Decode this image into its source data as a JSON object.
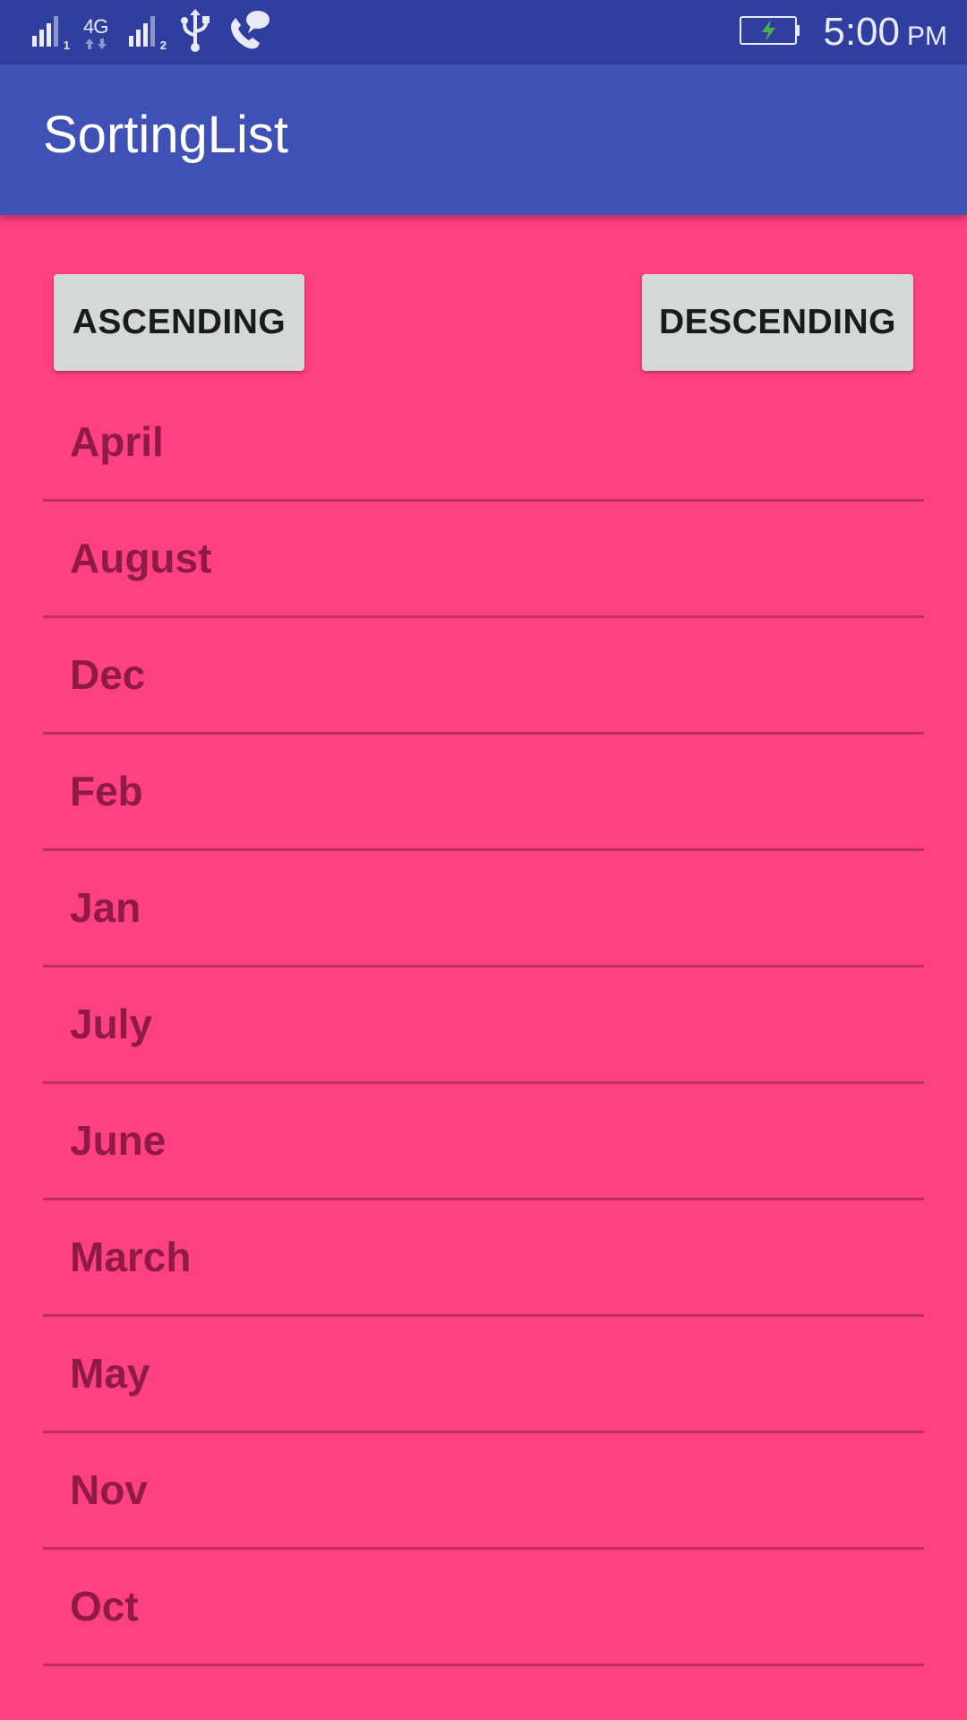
{
  "status_bar": {
    "sim1_label": "1",
    "network_label": "4G",
    "sim2_label": "2",
    "icons": [
      "signal-icon",
      "4g-icon",
      "signal-icon",
      "usb-icon",
      "phone-chat-icon",
      "battery-charging-icon"
    ],
    "time": "5:00",
    "ampm": "PM"
  },
  "app_bar": {
    "title": "SortingList"
  },
  "buttons": {
    "ascending": "ASCENDING",
    "descending": "DESCENDING"
  },
  "months": [
    {
      "label": "April"
    },
    {
      "label": "August"
    },
    {
      "label": "Dec"
    },
    {
      "label": "Feb"
    },
    {
      "label": "Jan"
    },
    {
      "label": "July"
    },
    {
      "label": "June"
    },
    {
      "label": "March"
    },
    {
      "label": "May"
    },
    {
      "label": "Nov"
    },
    {
      "label": "Oct"
    }
  ],
  "colors": {
    "status_bar": "#303f9f",
    "app_bar": "#3f51b5",
    "background": "#ff4081",
    "list_text": "#8e1a45",
    "divider": "#c0305f",
    "button": "#d6d7d7",
    "battery_bolt": "#4caf50"
  }
}
